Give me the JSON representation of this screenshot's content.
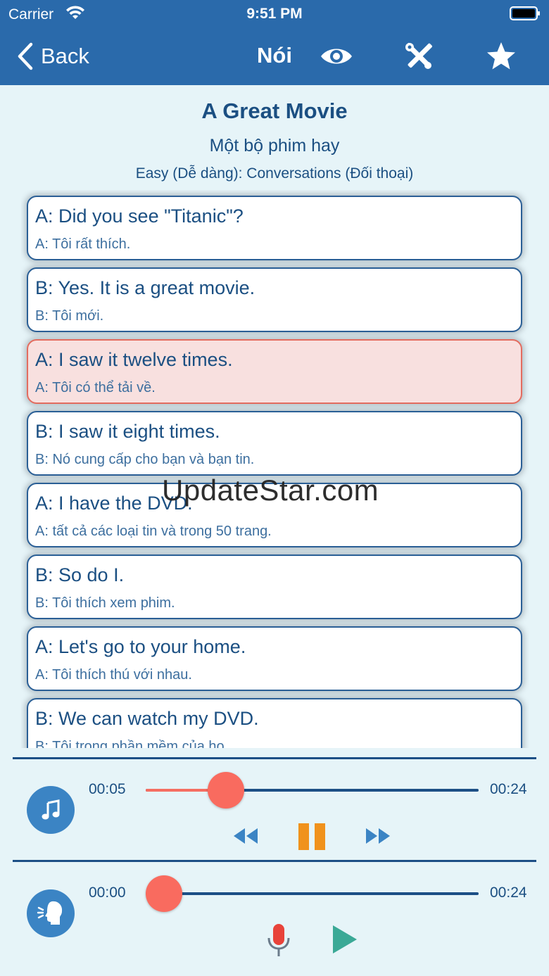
{
  "status_bar": {
    "carrier": "Carrier",
    "time": "9:51 PM"
  },
  "nav": {
    "back_label": "Back",
    "title": "Nói",
    "icons": [
      "eye-icon",
      "tools-icon",
      "star-icon"
    ]
  },
  "lesson": {
    "title": "A Great Movie",
    "subtitle": "Một bộ phim hay",
    "category": "Easy (Dễ dàng): Conversations (Đối thoại)"
  },
  "dialogue": [
    {
      "en": "A: Did you see \"Titanic\"?",
      "vi": "A: Tôi rất thích.",
      "active": false
    },
    {
      "en": "B: Yes. It is a great movie.",
      "vi": "B: Tôi mới.",
      "active": false
    },
    {
      "en": "A: I saw it twelve times.",
      "vi": "A: Tôi có thể tải về.",
      "active": true
    },
    {
      "en": "B: I saw it eight times.",
      "vi": "B: Nó cung cấp cho bạn và bạn tin.",
      "active": false
    },
    {
      "en": "A: I have the DVD.",
      "vi": "A: tất cả các loại tin và trong 50 trang.",
      "active": false
    },
    {
      "en": "B: So do I.",
      "vi": "B: Tôi thích xem phim.",
      "active": false
    },
    {
      "en": "A: Let's go to your home.",
      "vi": "A: Tôi thích thú với nhau.",
      "active": false
    },
    {
      "en": "B: We can watch my DVD.",
      "vi": "B: Tôi trong phần mềm của họ.",
      "active": false
    }
  ],
  "audio_player": {
    "elapsed": "00:05",
    "duration": "00:24",
    "progress": 0.24,
    "state": "playing"
  },
  "record_player": {
    "elapsed": "00:00",
    "duration": "00:24",
    "progress": 0.0
  },
  "watermark": "UpdateStar.com",
  "colors": {
    "nav_bar": "#2a6aab",
    "background": "#e6f4f8",
    "text": "#1b4f82",
    "active_card": "#f8e0df",
    "accent_red": "#f96b5f",
    "pause_orange": "#f0921c",
    "play_teal": "#3aa996"
  }
}
